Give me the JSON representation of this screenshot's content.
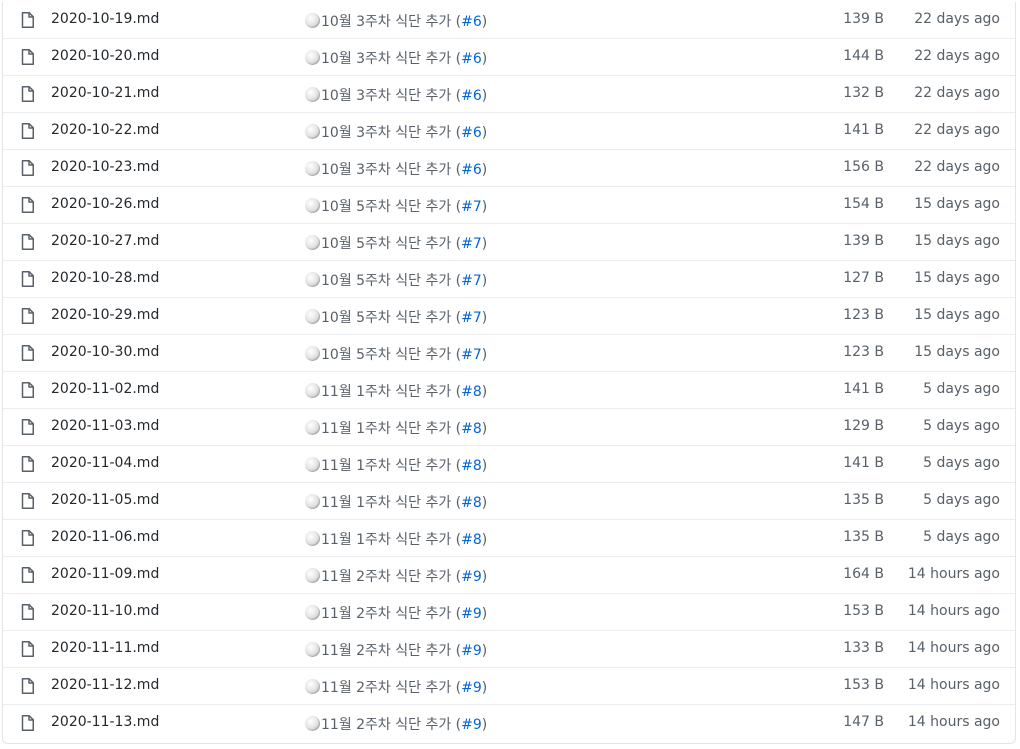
{
  "files": [
    {
      "name": "2020-10-19.md",
      "commit_msg": "10월 3주차 식단 추가 (",
      "pr": "#6",
      "commit_end": ")",
      "size": "139 B",
      "age": "22 days ago"
    },
    {
      "name": "2020-10-20.md",
      "commit_msg": "10월 3주차 식단 추가 (",
      "pr": "#6",
      "commit_end": ")",
      "size": "144 B",
      "age": "22 days ago"
    },
    {
      "name": "2020-10-21.md",
      "commit_msg": "10월 3주차 식단 추가 (",
      "pr": "#6",
      "commit_end": ")",
      "size": "132 B",
      "age": "22 days ago"
    },
    {
      "name": "2020-10-22.md",
      "commit_msg": "10월 3주차 식단 추가 (",
      "pr": "#6",
      "commit_end": ")",
      "size": "141 B",
      "age": "22 days ago"
    },
    {
      "name": "2020-10-23.md",
      "commit_msg": "10월 3주차 식단 추가 (",
      "pr": "#6",
      "commit_end": ")",
      "size": "156 B",
      "age": "22 days ago"
    },
    {
      "name": "2020-10-26.md",
      "commit_msg": "10월 5주차 식단 추가 (",
      "pr": "#7",
      "commit_end": ")",
      "size": "154 B",
      "age": "15 days ago"
    },
    {
      "name": "2020-10-27.md",
      "commit_msg": "10월 5주차 식단 추가 (",
      "pr": "#7",
      "commit_end": ")",
      "size": "139 B",
      "age": "15 days ago"
    },
    {
      "name": "2020-10-28.md",
      "commit_msg": "10월 5주차 식단 추가 (",
      "pr": "#7",
      "commit_end": ")",
      "size": "127 B",
      "age": "15 days ago"
    },
    {
      "name": "2020-10-29.md",
      "commit_msg": "10월 5주차 식단 추가 (",
      "pr": "#7",
      "commit_end": ")",
      "size": "123 B",
      "age": "15 days ago"
    },
    {
      "name": "2020-10-30.md",
      "commit_msg": "10월 5주차 식단 추가 (",
      "pr": "#7",
      "commit_end": ")",
      "size": "123 B",
      "age": "15 days ago"
    },
    {
      "name": "2020-11-02.md",
      "commit_msg": "11월 1주차 식단 추가 (",
      "pr": "#8",
      "commit_end": ")",
      "size": "141 B",
      "age": "5 days ago"
    },
    {
      "name": "2020-11-03.md",
      "commit_msg": "11월 1주차 식단 추가 (",
      "pr": "#8",
      "commit_end": ")",
      "size": "129 B",
      "age": "5 days ago"
    },
    {
      "name": "2020-11-04.md",
      "commit_msg": "11월 1주차 식단 추가 (",
      "pr": "#8",
      "commit_end": ")",
      "size": "141 B",
      "age": "5 days ago"
    },
    {
      "name": "2020-11-05.md",
      "commit_msg": "11월 1주차 식단 추가 (",
      "pr": "#8",
      "commit_end": ")",
      "size": "135 B",
      "age": "5 days ago"
    },
    {
      "name": "2020-11-06.md",
      "commit_msg": "11월 1주차 식단 추가 (",
      "pr": "#8",
      "commit_end": ")",
      "size": "135 B",
      "age": "5 days ago"
    },
    {
      "name": "2020-11-09.md",
      "commit_msg": "11월 2주차 식단 추가 (",
      "pr": "#9",
      "commit_end": ")",
      "size": "164 B",
      "age": "14 hours ago"
    },
    {
      "name": "2020-11-10.md",
      "commit_msg": "11월 2주차 식단 추가 (",
      "pr": "#9",
      "commit_end": ")",
      "size": "153 B",
      "age": "14 hours ago"
    },
    {
      "name": "2020-11-11.md",
      "commit_msg": "11월 2주차 식단 추가 (",
      "pr": "#9",
      "commit_end": ")",
      "size": "133 B",
      "age": "14 hours ago"
    },
    {
      "name": "2020-11-12.md",
      "commit_msg": "11월 2주차 식단 추가 (",
      "pr": "#9",
      "commit_end": ")",
      "size": "153 B",
      "age": "14 hours ago"
    },
    {
      "name": "2020-11-13.md",
      "commit_msg": "11월 2주차 식단 추가 (",
      "pr": "#9",
      "commit_end": ")",
      "size": "147 B",
      "age": "14 hours ago"
    }
  ],
  "icons": {
    "file": "file-icon",
    "commit_emoji": "rice-ball-emoji"
  },
  "colors": {
    "link": "#0366d6",
    "text": "#24292e",
    "muted": "#586069",
    "border": "#eaecef"
  }
}
